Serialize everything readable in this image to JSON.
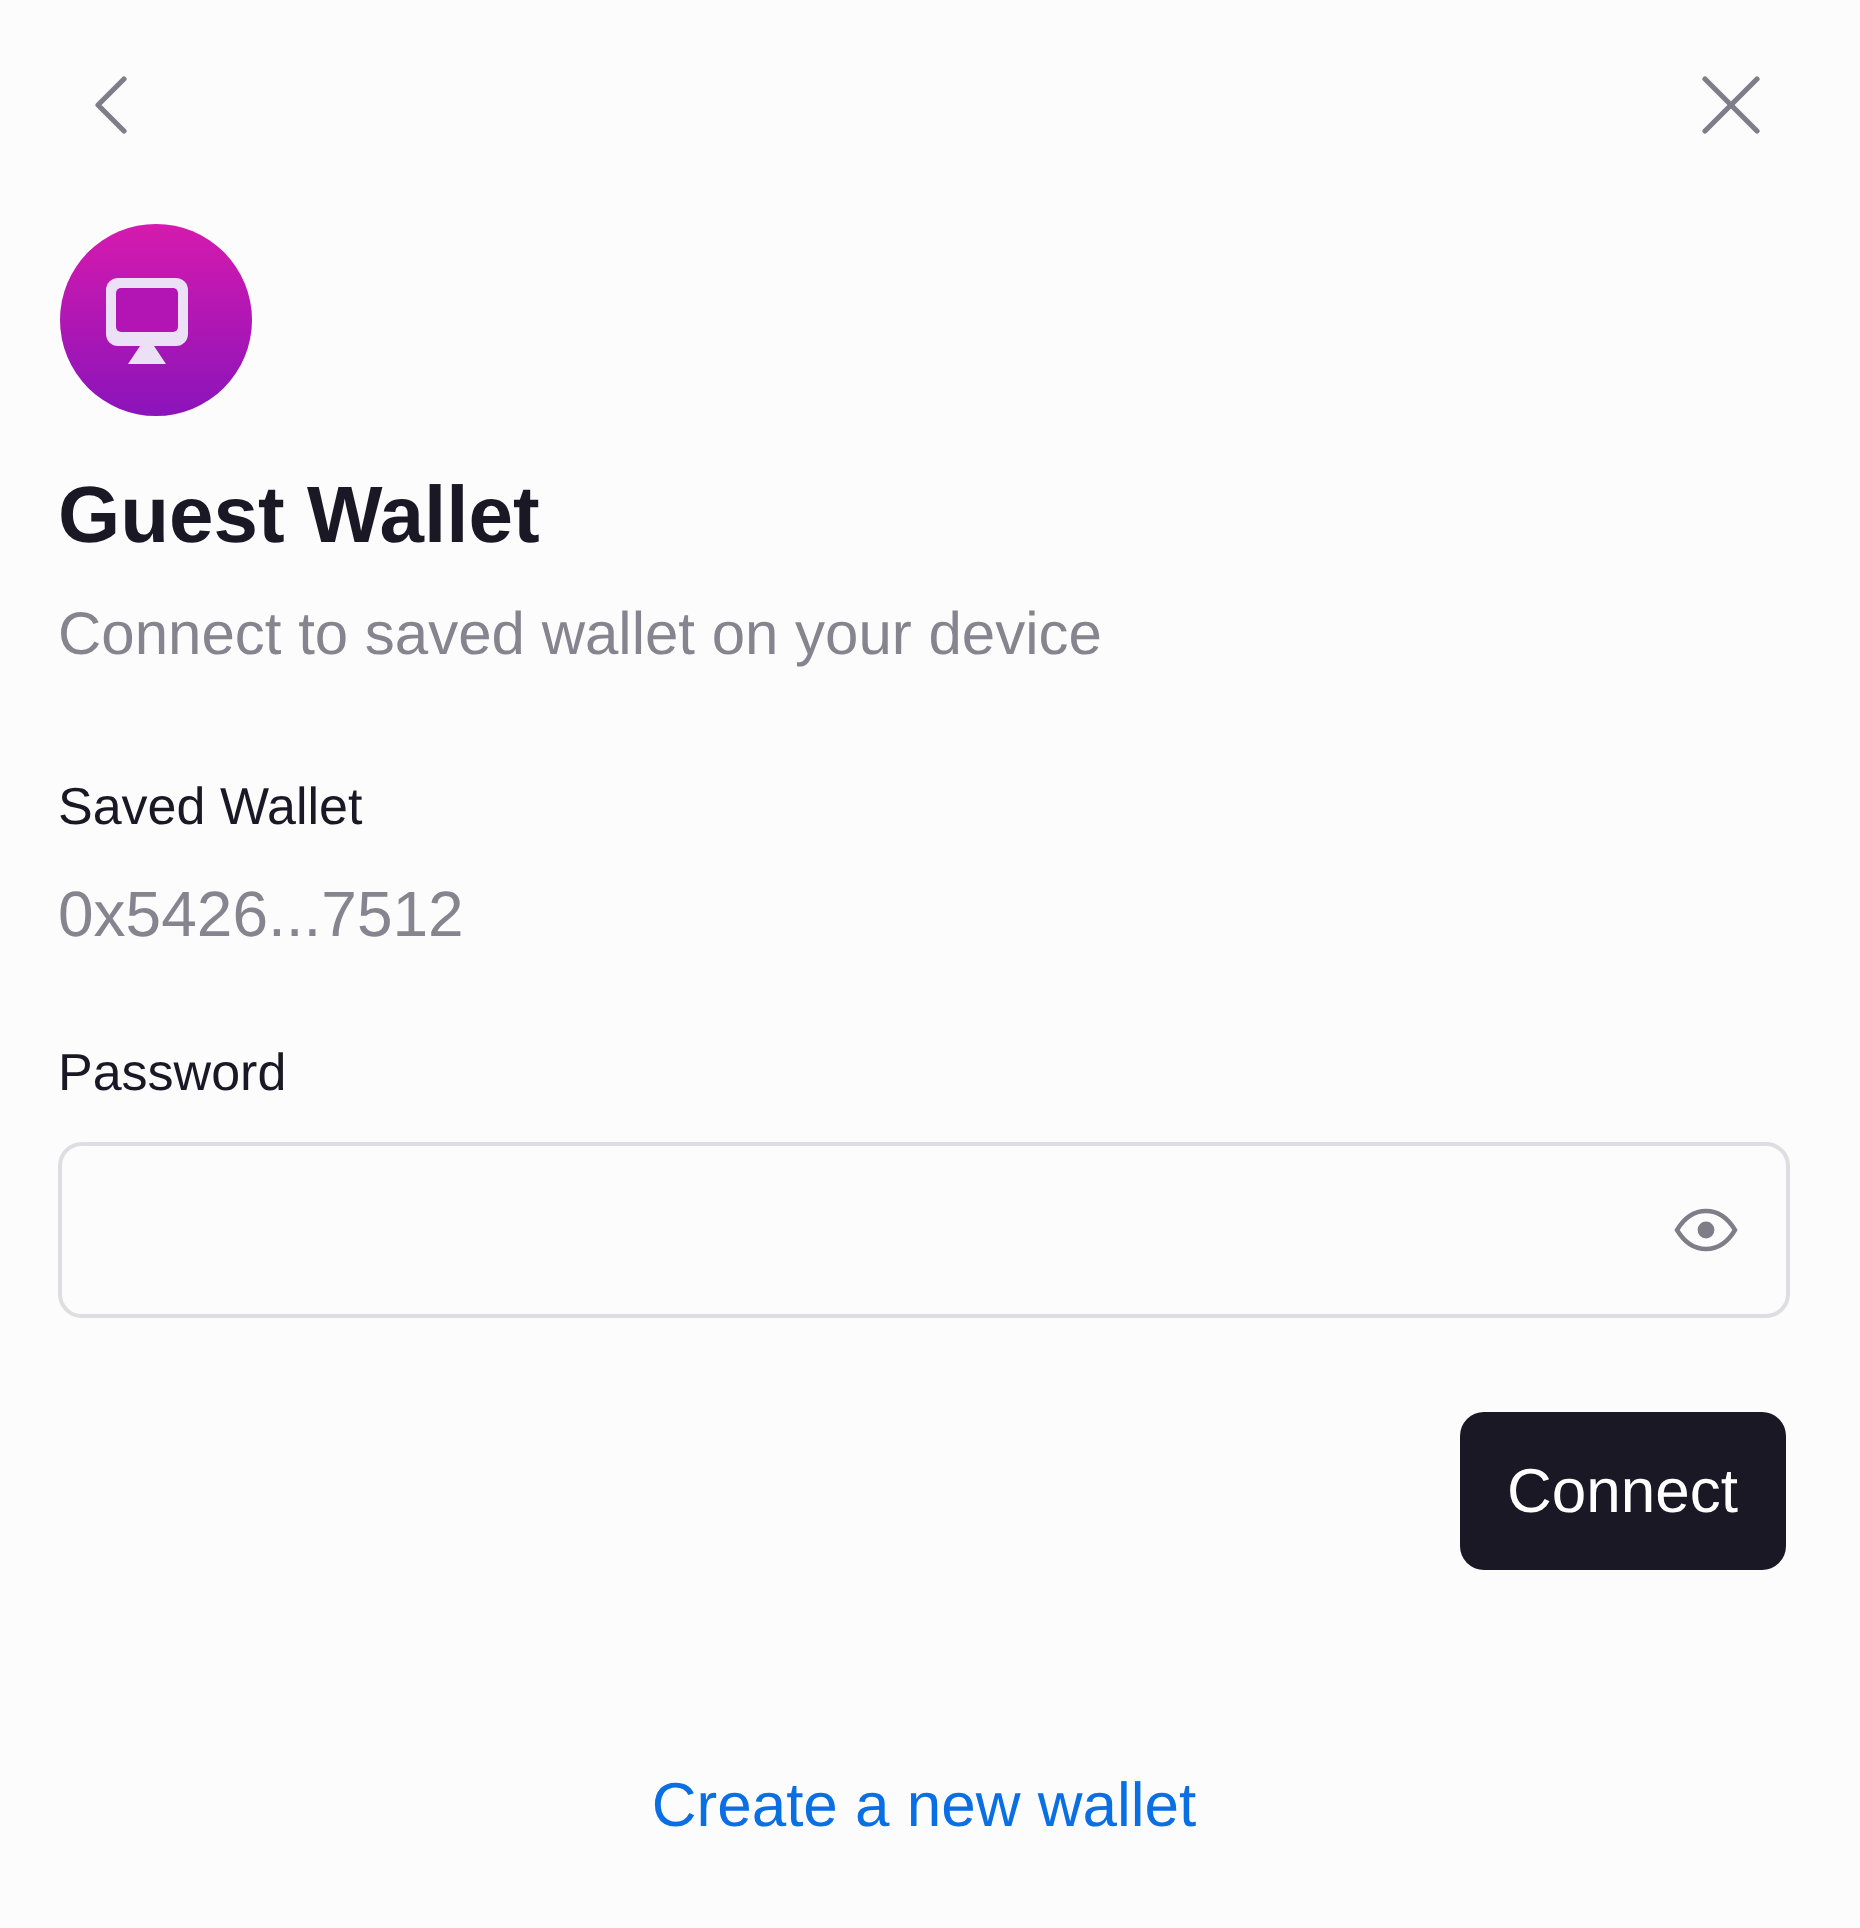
{
  "title": "Guest Wallet",
  "subtitle": "Connect to saved wallet on your device",
  "saved_wallet": {
    "label": "Saved Wallet",
    "value": "0x5426...7512"
  },
  "password": {
    "label": "Password"
  },
  "connect_button": "Connect",
  "create_link": "Create a new wallet"
}
